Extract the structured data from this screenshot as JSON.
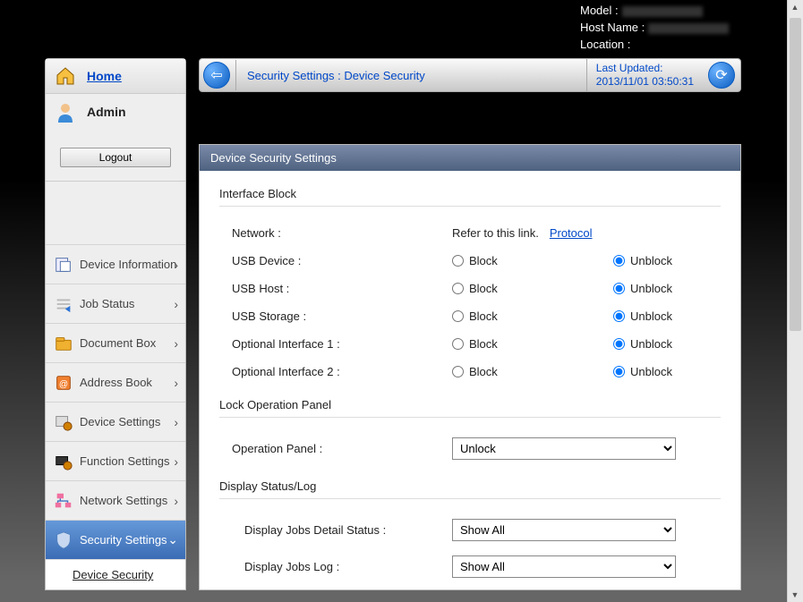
{
  "header_info": {
    "model_label": "Model :",
    "hostname_label": "Host Name :",
    "location_label": "Location :"
  },
  "sidebar": {
    "home_label": "Home",
    "admin_name": "Admin",
    "logout_label": "Logout",
    "items": [
      {
        "label": "Device Information"
      },
      {
        "label": "Job Status"
      },
      {
        "label": "Document Box"
      },
      {
        "label": "Address Book"
      },
      {
        "label": "Device Settings"
      },
      {
        "label": "Function Settings"
      },
      {
        "label": "Network Settings"
      },
      {
        "label": "Security Settings"
      }
    ],
    "sub_item": "Device Security"
  },
  "breadcrumb": {
    "title": "Security Settings : Device Security",
    "updated_label": "Last Updated:",
    "updated_value": "2013/11/01 03:50:31"
  },
  "panel": {
    "title": "Device Security Settings",
    "interface_block": {
      "title": "Interface Block",
      "network_label": "Network :",
      "network_text": "Refer to this link.",
      "protocol_link": "Protocol",
      "rows": [
        {
          "label": "USB Device :",
          "selected": "unblock"
        },
        {
          "label": "USB Host :",
          "selected": "unblock"
        },
        {
          "label": "USB Storage :",
          "selected": "unblock"
        },
        {
          "label": "Optional Interface 1 :",
          "selected": "unblock"
        },
        {
          "label": "Optional Interface 2 :",
          "selected": "unblock"
        }
      ],
      "block_label": "Block",
      "unblock_label": "Unblock"
    },
    "lock_panel": {
      "title": "Lock Operation Panel",
      "label": "Operation Panel :",
      "value": "Unlock"
    },
    "display_status": {
      "title": "Display Status/Log",
      "rows": [
        {
          "label": "Display Jobs Detail Status :",
          "value": "Show All"
        },
        {
          "label": "Display Jobs Log :",
          "value": "Show All"
        }
      ]
    }
  }
}
